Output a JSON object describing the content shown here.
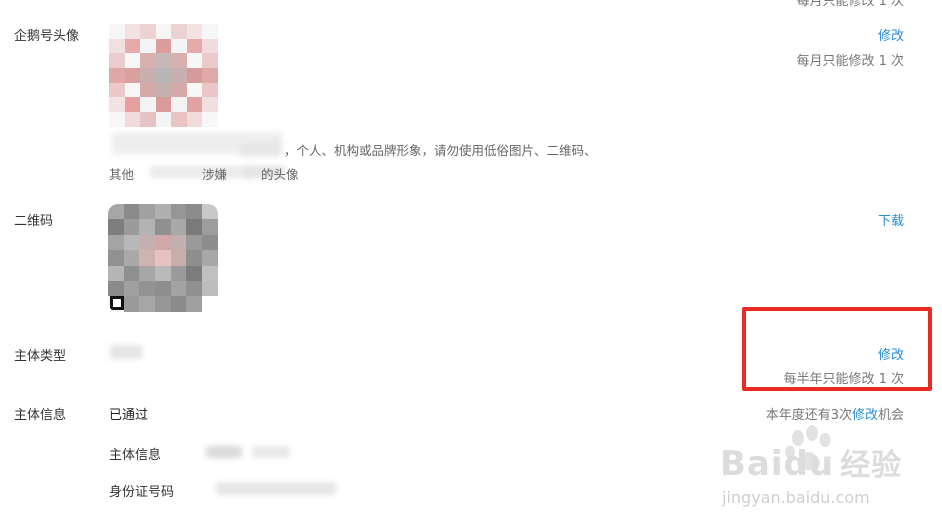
{
  "colors": {
    "link": "#2a8fd6",
    "highlight_box": "#ec2a24",
    "muted": "#777777"
  },
  "top_cut_note": "每月只能修改 1 次",
  "avatar": {
    "label": "企鹅号头像",
    "action": "修改",
    "note": "每月只能修改 1 次",
    "hint_line1": "，个人、机构或品牌形象，请勿使用低俗图片、二维码、",
    "hint_line2_a": "其他",
    "hint_line2_b": "涉嫌",
    "hint_line2_c": "的头像"
  },
  "qrcode": {
    "label": "二维码",
    "action": "下载"
  },
  "entity_type": {
    "label": "主体类型",
    "action": "修改",
    "note": "每半年只能修改 1 次"
  },
  "entity_info": {
    "label": "主体信息",
    "status": "已通过",
    "remaining_prefix": "本年度还有3次",
    "remaining_link": "修改",
    "remaining_suffix": "机会",
    "sub_fields": [
      {
        "label": "主体信息"
      },
      {
        "label": "身份证号码"
      }
    ]
  },
  "watermark": {
    "brand": "Baidu",
    "brand_cn": "经验",
    "url": "jingyan.baidu.com"
  }
}
